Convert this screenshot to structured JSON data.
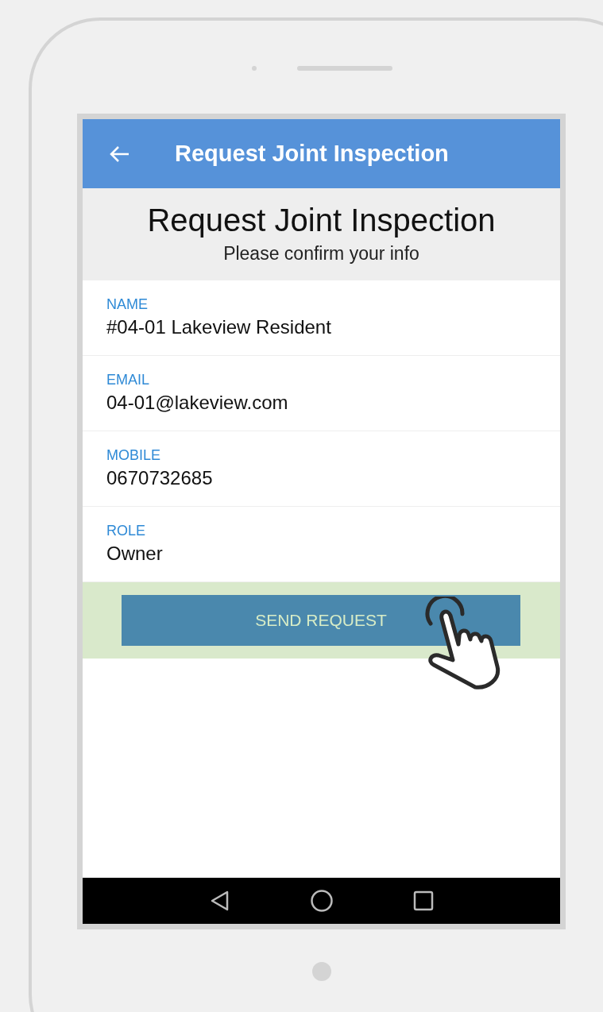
{
  "app_bar": {
    "title": "Request Joint Inspection"
  },
  "header": {
    "title": "Request Joint Inspection",
    "subtitle": "Please confirm your info"
  },
  "fields": [
    {
      "label": "NAME",
      "value": "#04-01 Lakeview Resident"
    },
    {
      "label": "EMAIL",
      "value": "04-01@lakeview.com"
    },
    {
      "label": "MOBILE",
      "value": "0670732685"
    },
    {
      "label": "ROLE",
      "value": "Owner"
    }
  ],
  "action": {
    "label": "SEND REQUEST"
  }
}
